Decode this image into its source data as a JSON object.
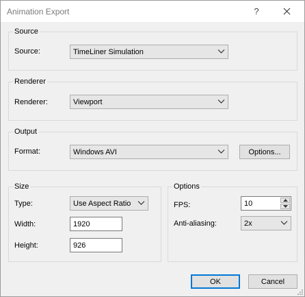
{
  "window": {
    "title": "Animation Export",
    "help_glyph": "?"
  },
  "source": {
    "group_label": "Source",
    "field_label": "Source:",
    "value": "TimeLiner Simulation"
  },
  "renderer": {
    "group_label": "Renderer",
    "field_label": "Renderer:",
    "value": "Viewport"
  },
  "output": {
    "group_label": "Output",
    "field_label": "Format:",
    "value": "Windows AVI",
    "options_label": "Options..."
  },
  "size": {
    "group_label": "Size",
    "type_label": "Type:",
    "type_value": "Use Aspect Ratio",
    "width_label": "Width:",
    "width_value": "1920",
    "height_label": "Height:",
    "height_value": "926"
  },
  "options": {
    "group_label": "Options",
    "fps_label": "FPS:",
    "fps_value": "10",
    "aa_label": "Anti-aliasing:",
    "aa_value": "2x"
  },
  "footer": {
    "ok_label": "OK",
    "cancel_label": "Cancel"
  },
  "icons": {
    "close": "close-icon",
    "dropdown": "chevron-down-icon",
    "spin_up": "arrow-up-icon",
    "spin_down": "arrow-down-icon",
    "grip": "resize-grip-icon"
  },
  "colors": {
    "accent": "#0078d7",
    "window_bg": "#f0f0f0",
    "title_text": "#7a7a7a"
  }
}
